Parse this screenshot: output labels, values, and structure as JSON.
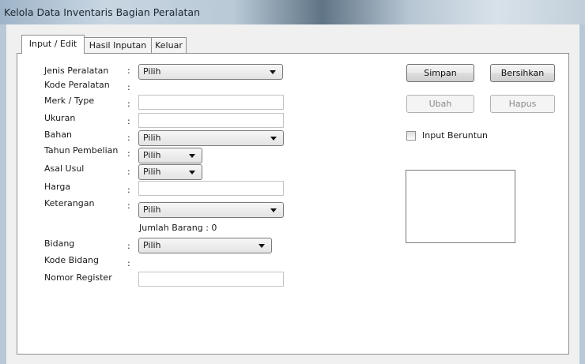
{
  "window": {
    "title": "Kelola Data Inventaris Bagian Peralatan"
  },
  "tabs": [
    {
      "label": "Input / Edit",
      "active": true
    },
    {
      "label": "Hasil Inputan",
      "active": false
    },
    {
      "label": "Keluar",
      "active": false
    }
  ],
  "form": {
    "colon": ":",
    "jenis_peralatan": {
      "label": "Jenis Peralatan",
      "value": "Pilih"
    },
    "kode_peralatan": {
      "label": "Kode Peralatan"
    },
    "merk_type": {
      "label": "Merk / Type",
      "value": ""
    },
    "ukuran": {
      "label": "Ukuran",
      "value": ""
    },
    "bahan": {
      "label": "Bahan",
      "value": "Pilih"
    },
    "tahun_pembelian": {
      "label": "Tahun Pembelian",
      "value": "Pilih"
    },
    "asal_usul": {
      "label": "Asal Usul",
      "value": "Pilih"
    },
    "harga": {
      "label": "Harga",
      "value": ""
    },
    "keterangan": {
      "label": "Keterangan",
      "value": "Pilih"
    },
    "jumlah_barang": "Jumlah Barang : 0",
    "bidang": {
      "label": "Bidang",
      "value": "Pilih"
    },
    "kode_bidang": {
      "label": "Kode Bidang"
    },
    "nomor_register": {
      "label": "Nomor Register",
      "value": ""
    }
  },
  "actions": {
    "simpan": "Simpan",
    "bersihkan": "Bersihkan",
    "ubah": "Ubah",
    "hapus": "Hapus",
    "input_beruntun": "Input Beruntun"
  },
  "colors": {
    "disabled_text": "#8a8a8a",
    "panel_bg": "#ffffff",
    "window_bg": "#f0f0f0"
  }
}
